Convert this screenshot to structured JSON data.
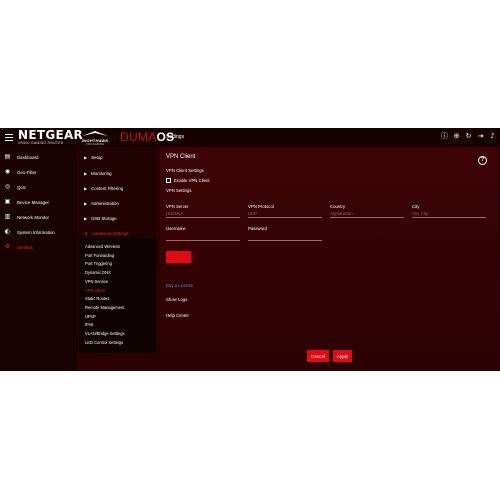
{
  "topbar": {
    "brand": "NETGEAR",
    "model": "XR500 GAMING ROUTER",
    "nighthawk": "NIGHTHAWK",
    "nighthawk_sub": "PRO GAMING",
    "duma_left": "DUMA",
    "duma_right": "OS",
    "page_title": "Settings",
    "icons": [
      "info-icon",
      "globe-icon",
      "refresh-icon",
      "logout-icon",
      "bell-icon"
    ]
  },
  "leftnav": {
    "items": [
      {
        "label": "Dashboard",
        "icon": "dashboard-icon",
        "glyph": "▤"
      },
      {
        "label": "Geo-Filter",
        "icon": "geo-filter-icon",
        "glyph": "◉"
      },
      {
        "label": "QoS",
        "icon": "qos-icon",
        "glyph": "◎"
      },
      {
        "label": "Device Manager",
        "icon": "device-manager-icon",
        "glyph": "▣"
      },
      {
        "label": "Network Monitor",
        "icon": "network-monitor-icon",
        "glyph": "▥"
      },
      {
        "label": "System Information",
        "icon": "system-info-icon",
        "glyph": "◐"
      },
      {
        "label": "Settings",
        "icon": "settings-icon",
        "glyph": "⚙"
      }
    ],
    "active_index": 6
  },
  "submenu": {
    "items": [
      {
        "label": "Setup",
        "tri": "▶"
      },
      {
        "label": "Monitoring",
        "tri": "▶"
      },
      {
        "label": "Content Filtering",
        "tri": "▶"
      },
      {
        "label": "Administration",
        "tri": "▶"
      },
      {
        "label": "USB Storage",
        "tri": "▶"
      },
      {
        "label": "Advanced Settings",
        "tri": "▼"
      }
    ],
    "advanced": [
      "Advanced Wireless",
      "Port Forwarding",
      "Port Triggering",
      "Dynamic DNS",
      "VPN Service",
      "VPN Client",
      "Static Routes",
      "Remote Management",
      "UPnP",
      "IPv6",
      "VLAN/Bridge Settings",
      "LED Control Settings"
    ],
    "advanced_active_index": 5
  },
  "main": {
    "title": "VPN Client",
    "client_settings_label": "VPN Client Settings",
    "enable_label": "Enable VPN Client",
    "enable_checked": false,
    "settings_label": "VPN Settings",
    "fields": {
      "server": {
        "label": "VPN Server",
        "placeholder": "HideMyA"
      },
      "protocol": {
        "label": "VPN Protocol",
        "placeholder": "UDP"
      },
      "country": {
        "label": "Country",
        "placeholder": "Afghanistan"
      },
      "city": {
        "label": "City",
        "placeholder": "Any City"
      },
      "username": {
        "label": "Username",
        "placeholder": ""
      },
      "password": {
        "label": "Password",
        "placeholder": ""
      }
    },
    "buy_license": "Buy a License",
    "show_logs": "Show Logs",
    "help_center": "Help Center",
    "cancel": "Cancel",
    "apply": "Apply"
  },
  "colors": {
    "accent": "#e00c12",
    "active_text": "#e02a2a",
    "link": "#4b8fe0",
    "background": "#2a0204"
  }
}
